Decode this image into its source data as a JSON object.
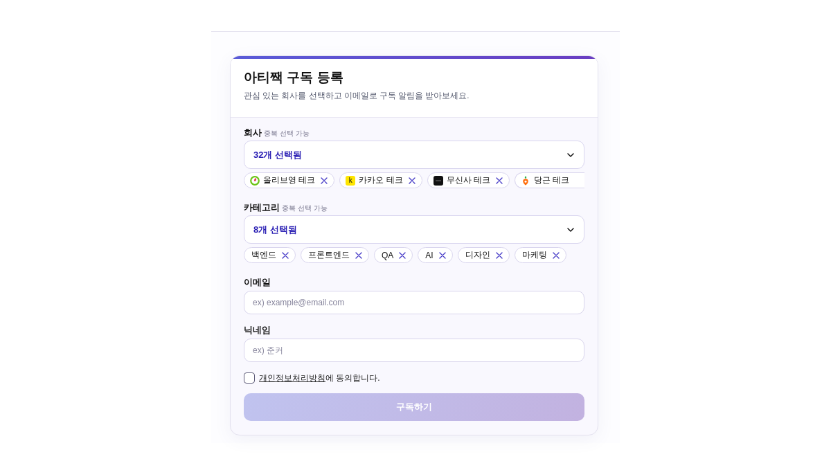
{
  "card": {
    "title": "아티짹 구독 등록",
    "subtitle": "관심 있는 회사를 선택하고 이메일로 구독 알림을 받아보세요."
  },
  "fields": [
    {
      "kind": "multiselect",
      "label": "회사",
      "hint": "중복 선택 가능",
      "value": "32개 선택됨",
      "chips": [
        {
          "label": "올리브영 테크",
          "kind": "ring",
          "cut": false
        },
        {
          "label": "카카오 테크",
          "kind": "letter",
          "logo_text": "k",
          "cut": false
        },
        {
          "label": "무신사 테크",
          "kind": "block",
          "cut": false
        },
        {
          "label": "당근 테크",
          "kind": "carrot",
          "cut": true
        }
      ]
    },
    {
      "kind": "multiselect",
      "label": "카테고리",
      "hint": "중복 선택 가능",
      "value": "8개 선택됨",
      "chips": [
        {
          "label": "백엔드",
          "kind": "plain",
          "cut": false
        },
        {
          "label": "프론트엔드",
          "kind": "plain",
          "cut": false
        },
        {
          "label": "QA",
          "kind": "plain",
          "cut": false
        },
        {
          "label": "AI",
          "kind": "plain",
          "cut": false
        },
        {
          "label": "디자인",
          "kind": "plain",
          "cut": false
        },
        {
          "label": "마케팅",
          "kind": "plain",
          "cut": false
        }
      ]
    },
    {
      "kind": "text",
      "label": "이메일",
      "placeholder": "ex) example@email.com"
    },
    {
      "kind": "text",
      "label": "닉네임",
      "placeholder": "ex) 준커"
    }
  ],
  "consent": {
    "checked": false,
    "link": "개인정보처리방침",
    "text": "에 동의합니다."
  },
  "submit": {
    "label": "구독하기",
    "disabled": true
  }
}
